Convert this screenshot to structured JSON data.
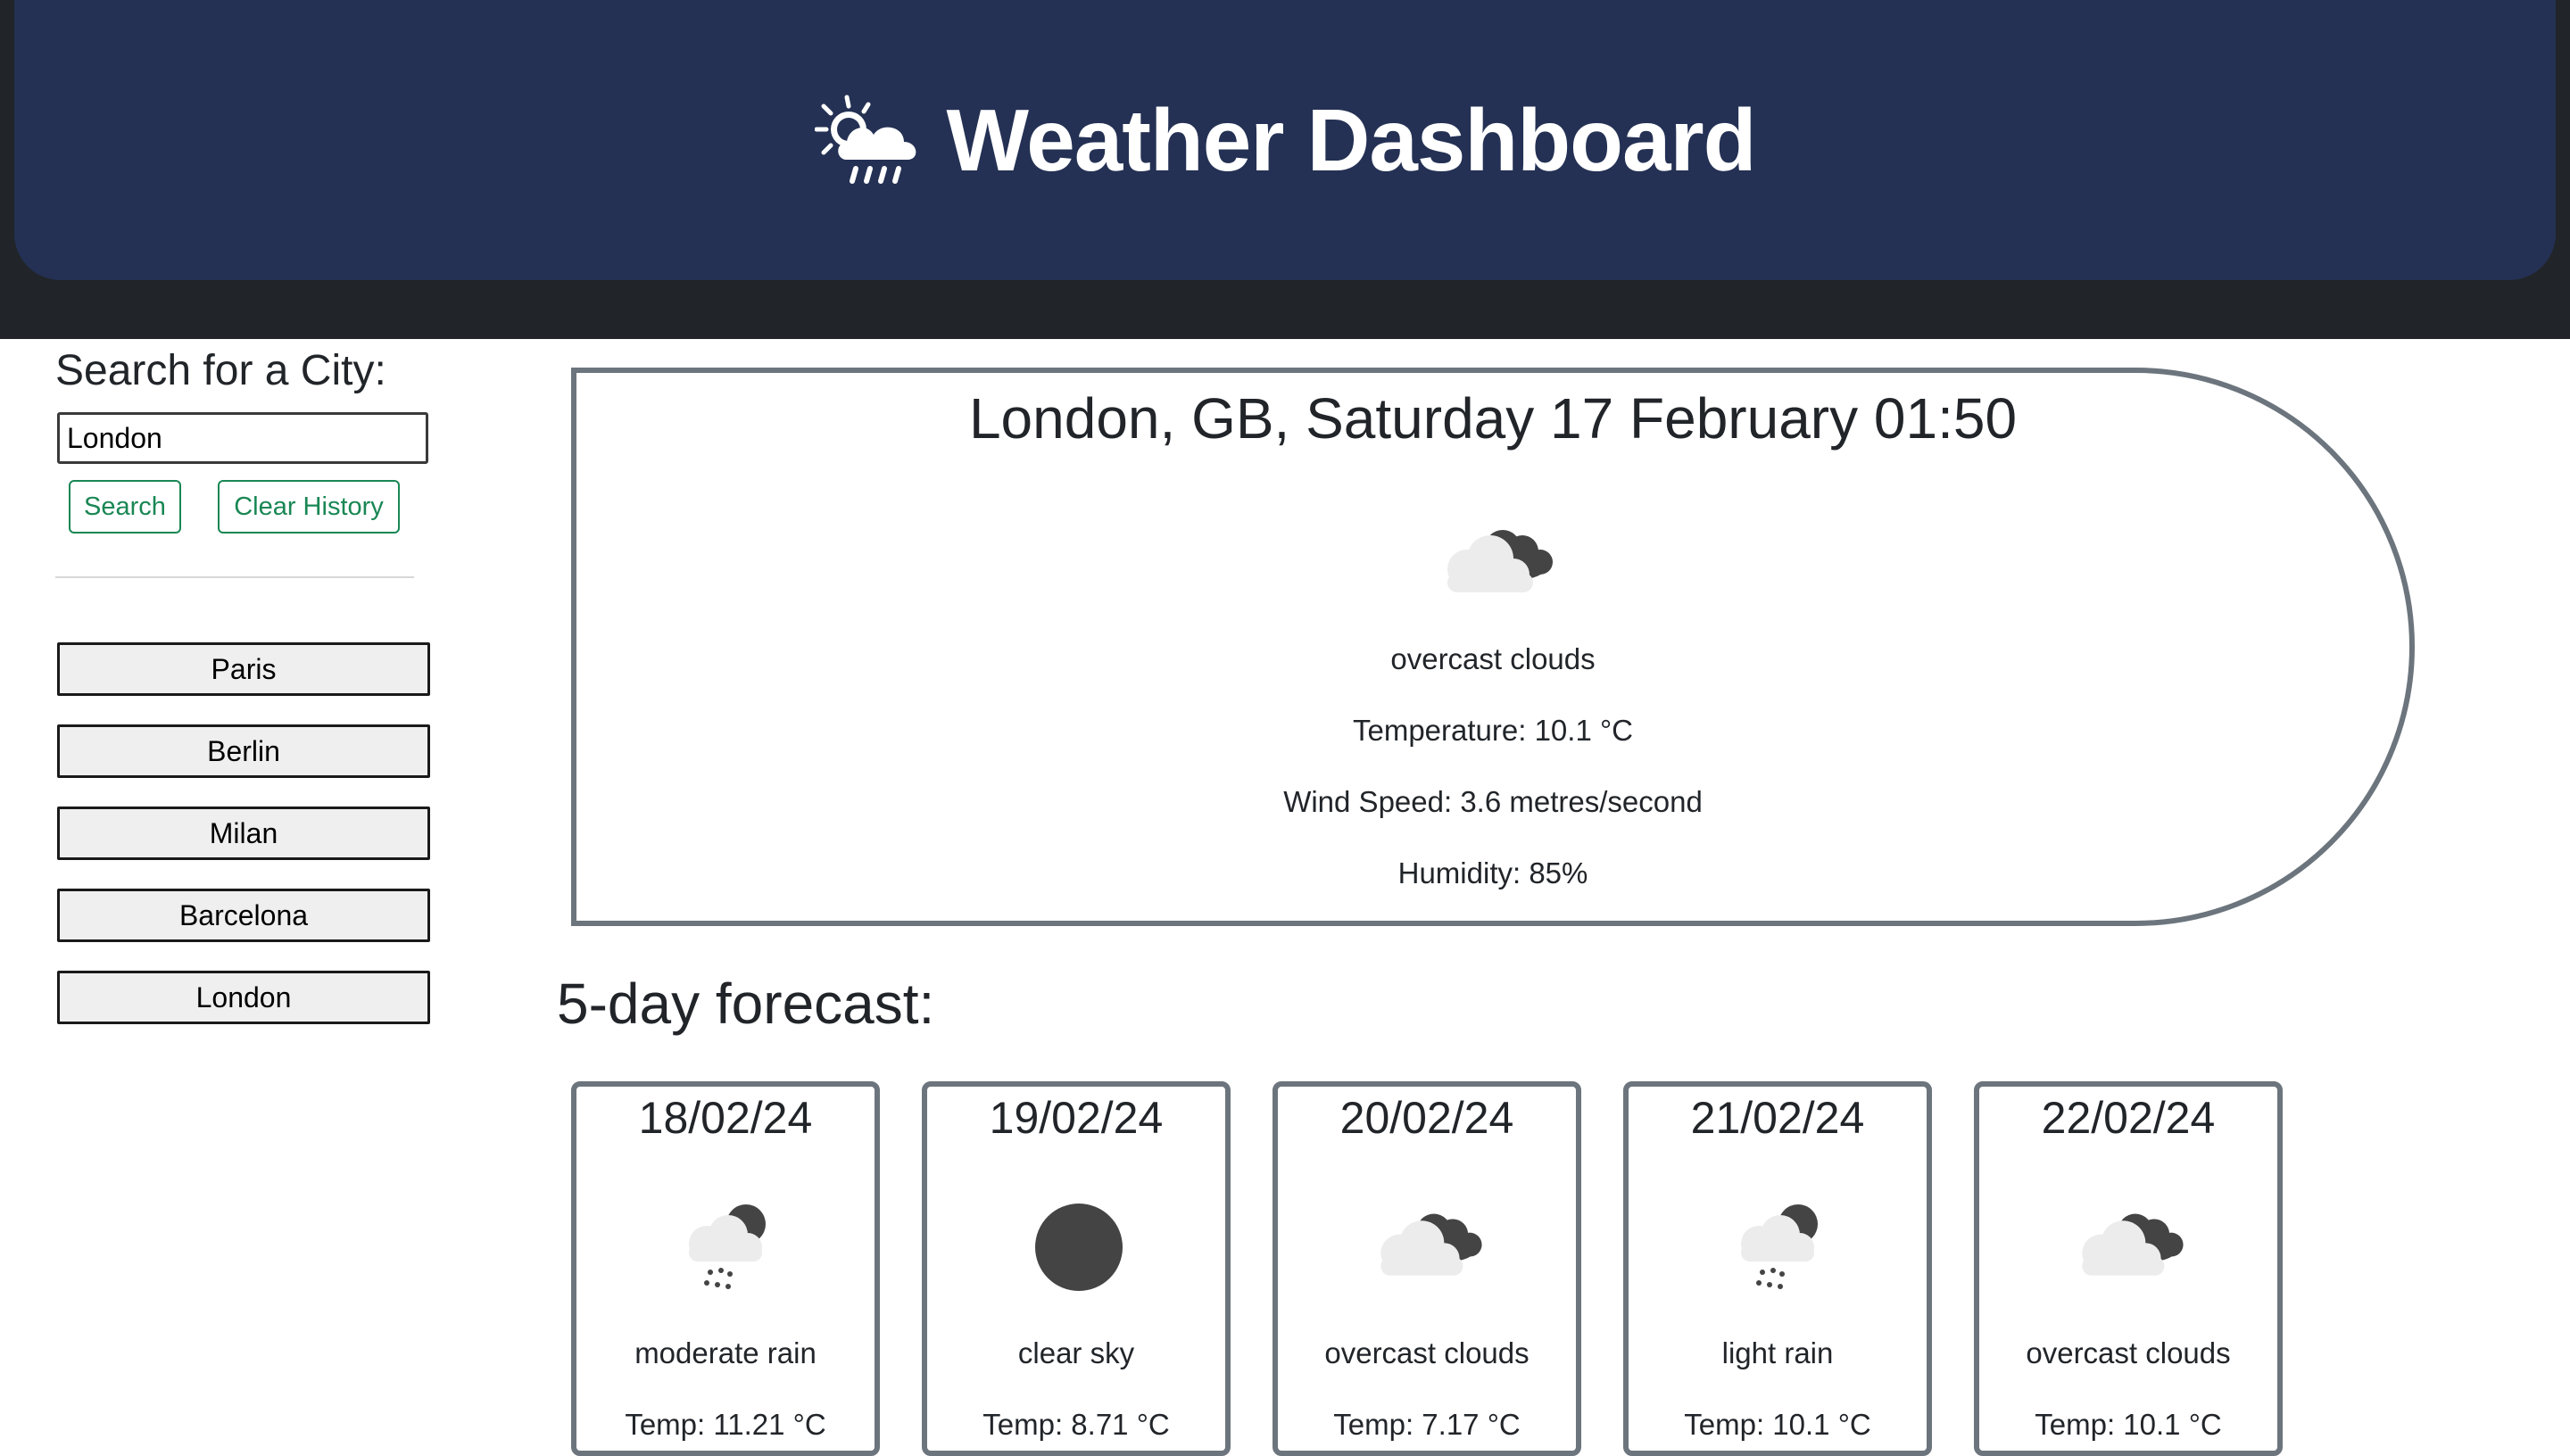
{
  "header": {
    "title": "Weather Dashboard",
    "logo_icon": "sun-cloud-rain-icon"
  },
  "sidebar": {
    "search_label": "Search for a City:",
    "search_value": "London",
    "search_button": "Search",
    "clear_button": "Clear History",
    "history": [
      "Paris",
      "Berlin",
      "Milan",
      "Barcelona",
      "London"
    ]
  },
  "current": {
    "title": "London, GB, Saturday 17 February 01:50",
    "icon": "overcast-clouds-icon",
    "description": "overcast clouds",
    "temperature": "Temperature: 10.1 °C",
    "wind": "Wind Speed: 3.6 metres/second",
    "humidity": "Humidity: 85%"
  },
  "forecast": {
    "heading": "5-day forecast:",
    "days": [
      {
        "date": "18/02/24",
        "icon": "rain-icon",
        "description": "moderate rain",
        "temp": "Temp: 11.21 °C"
      },
      {
        "date": "19/02/24",
        "icon": "clear-sky-icon",
        "description": "clear sky",
        "temp": "Temp: 8.71 °C"
      },
      {
        "date": "20/02/24",
        "icon": "overcast-clouds-icon",
        "description": "overcast clouds",
        "temp": "Temp: 7.17 °C"
      },
      {
        "date": "21/02/24",
        "icon": "rain-icon",
        "description": "light rain",
        "temp": "Temp: 10.1 °C"
      },
      {
        "date": "22/02/24",
        "icon": "overcast-clouds-icon",
        "description": "overcast clouds",
        "temp": "Temp: 10.1 °C"
      }
    ]
  },
  "colors": {
    "header_bg": "#243154",
    "page_band": "#212529",
    "accent_green": "#198754",
    "card_border": "#6c757d"
  }
}
